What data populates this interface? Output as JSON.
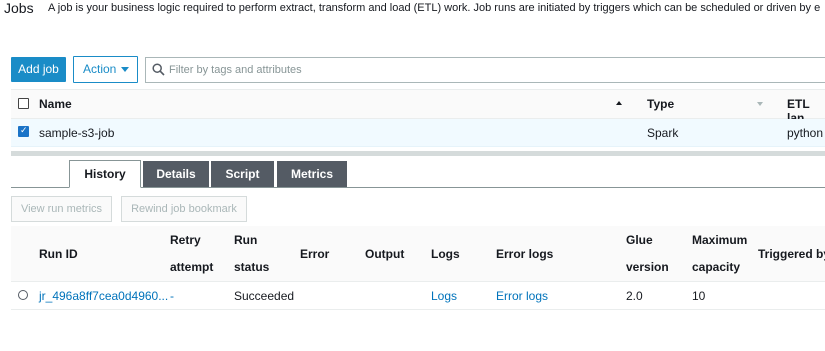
{
  "header": {
    "title": "Jobs",
    "description": "A job is your business logic required to perform extract, transform and load (ETL) work. Job runs are initiated by triggers which can be scheduled or driven by e"
  },
  "toolbar": {
    "add_job_label": "Add job",
    "action_label": "Action",
    "search_placeholder": "Filter by tags and attributes"
  },
  "jobs_table": {
    "columns": [
      "Name",
      "Type",
      "ETL lan"
    ],
    "rows": [
      {
        "name": "sample-s3-job",
        "type": "Spark",
        "etl_language": "python",
        "selected": true
      }
    ]
  },
  "detail_tabs": [
    "History",
    "Details",
    "Script",
    "Metrics"
  ],
  "active_tab": "History",
  "history_actions": {
    "view_run_metrics": "View run metrics",
    "rewind_bookmark": "Rewind job bookmark"
  },
  "runs_table": {
    "columns": {
      "run_id": "Run ID",
      "retry_1": "Retry",
      "retry_2": "attempt",
      "status_1": "Run",
      "status_2": "status",
      "error": "Error",
      "output": "Output",
      "logs": "Logs",
      "error_logs": "Error logs",
      "glue_1": "Glue",
      "glue_2": "version",
      "cap_1": "Maximum",
      "cap_2": "capacity",
      "triggered": "Triggered by"
    },
    "rows": [
      {
        "run_id": "jr_496a8ff7cea0d4960...",
        "retry_attempt": "-",
        "run_status": "Succeeded",
        "logs": "Logs",
        "error_logs": "Error logs",
        "glue_version": "2.0",
        "maximum_capacity": "10"
      }
    ]
  },
  "colors": {
    "primary": "#1a8cc7",
    "link": "#0073bb",
    "selected_row": "#f1faff",
    "inactive_tab": "#545b64"
  }
}
